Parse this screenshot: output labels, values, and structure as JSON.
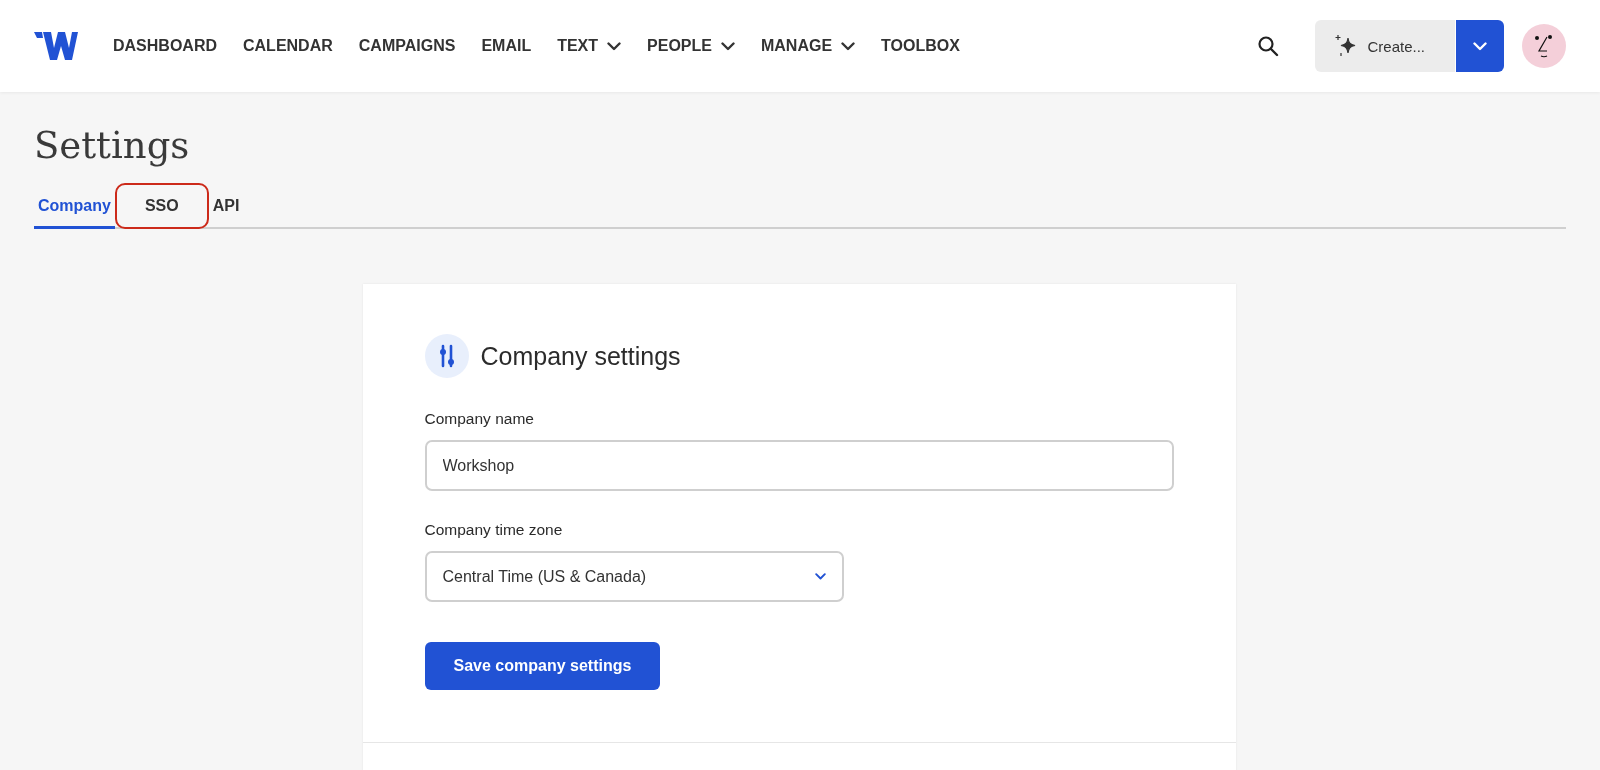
{
  "nav": {
    "items": [
      {
        "label": "DASHBOARD",
        "dropdown": false
      },
      {
        "label": "CALENDAR",
        "dropdown": false
      },
      {
        "label": "CAMPAIGNS",
        "dropdown": false
      },
      {
        "label": "EMAIL",
        "dropdown": false
      },
      {
        "label": "TEXT",
        "dropdown": true
      },
      {
        "label": "PEOPLE",
        "dropdown": true
      },
      {
        "label": "MANAGE",
        "dropdown": true
      },
      {
        "label": "TOOLBOX",
        "dropdown": false
      }
    ],
    "create_button": "Create..."
  },
  "page_title": "Settings",
  "tabs": [
    {
      "label": "Company",
      "selected": true,
      "highlighted": false
    },
    {
      "label": "SSO",
      "selected": false,
      "highlighted": true
    },
    {
      "label": "API",
      "selected": false,
      "highlighted": false
    }
  ],
  "card": {
    "title": "Company settings",
    "fields": [
      {
        "kind": "text",
        "label": "Company name",
        "value": "Workshop"
      },
      {
        "kind": "select",
        "label": "Company time zone",
        "value": "Central Time (US & Canada)"
      }
    ],
    "save_button": "Save company settings"
  }
}
